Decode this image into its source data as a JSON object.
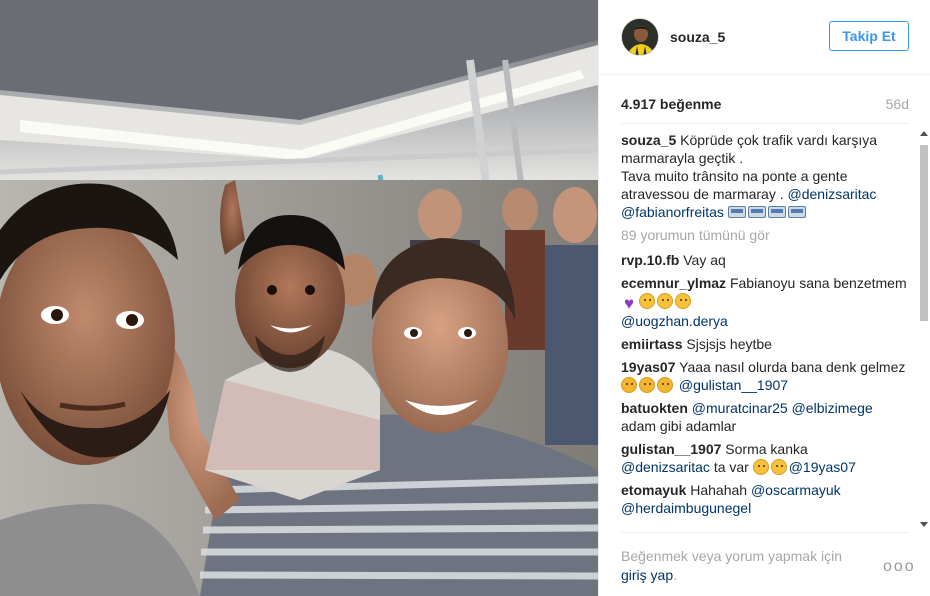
{
  "post": {
    "username": "souza_5",
    "follow_label": "Takip Et",
    "likes": "4.917 beğenme",
    "age": "56d"
  },
  "caption": {
    "user": "souza_5",
    "line1": "Köprüde çok trafik vardı karşıya marmarayla geçtik .",
    "line2": "Tava muito trânsito na ponte a gente atravessou de marmaray .",
    "mention1": "@denizsaritac",
    "mention2": "@fabianorfreitas"
  },
  "view_all": "89 yorumun tümünü gör",
  "comments": [
    {
      "user": "rvp.10.fb",
      "text": "Vay aq"
    },
    {
      "user": "ecemnur_ylmaz",
      "text": "Fabianoyu sana benzetmem",
      "mention": "@uogzhan.derya"
    },
    {
      "user": "emiirtass",
      "text": "Sjsjsjs heytbe"
    },
    {
      "user": "19yas07",
      "text": "Yaaa nasıl olurda bana denk gelmez",
      "mention": "@gulistan__1907"
    },
    {
      "user": "batuokten",
      "mention_a": "@muratcinar25",
      "mention_b": "@elbizimege",
      "text": "adam gibi adamlar"
    },
    {
      "user": "gulistan__1907",
      "text": "Sorma kanka",
      "mention_a": "@denizsaritac",
      "text2": "ta var",
      "mention_b": "@19yas07"
    },
    {
      "user": "etomayuk",
      "text": "Hahahah",
      "mention_a": "@oscarmayuk",
      "mention_b": "@herdaimbugunegel"
    }
  ],
  "footer": {
    "login_text": "Beğenmek veya yorum yapmak için",
    "login_link": "giriş yap",
    "login_end": ".",
    "more": "ooo"
  },
  "icons": {
    "more": "more-options-icon",
    "emoji_heart": "purple-heart-emoji",
    "emoji_grin": "grinning-emoji",
    "emoji_sad": "disappointed-emoji",
    "emoji_smile": "smiling-emoji",
    "emoji_train": "train-emoji"
  },
  "colors": {
    "accent": "#3897f0",
    "mention": "#003569",
    "muted": "#a5a7aa",
    "text": "#262626"
  }
}
